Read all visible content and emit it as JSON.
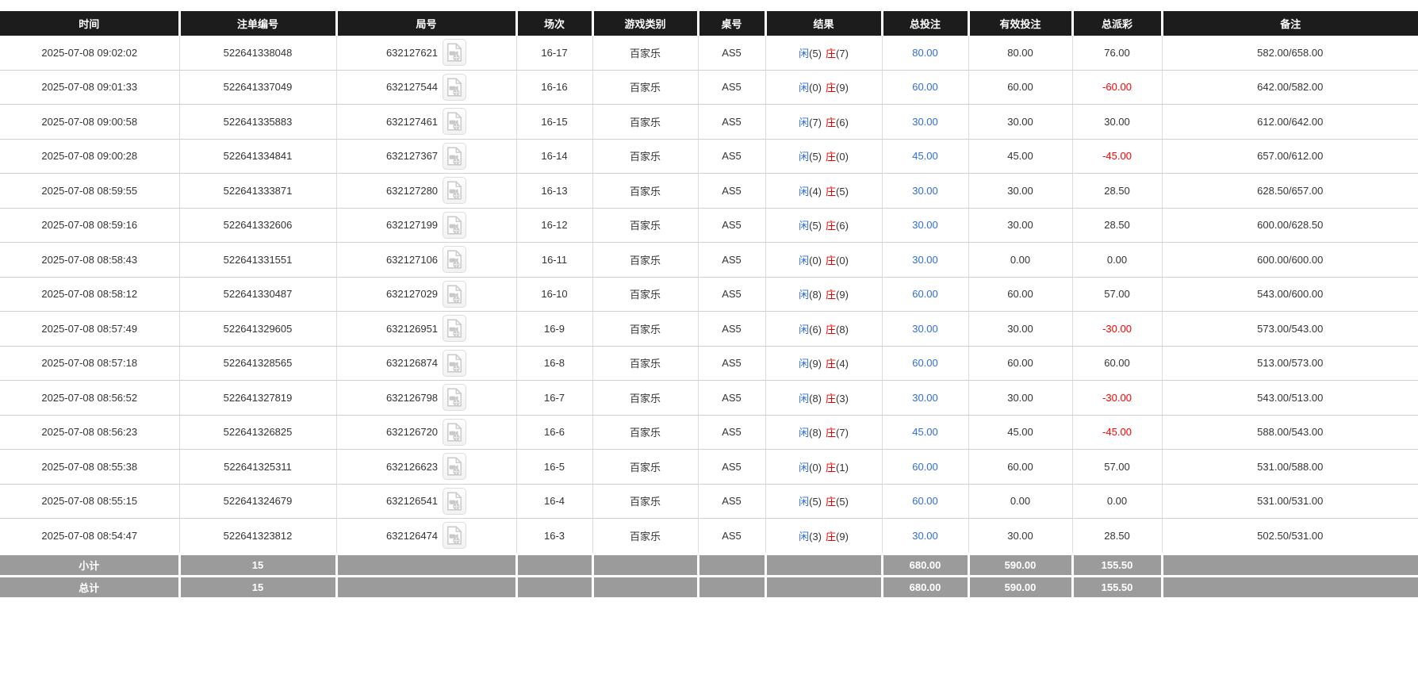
{
  "colors": {
    "header-bg": "#1c1c1c",
    "header-text": "#ffffff",
    "footer-bg": "#9b9b9b",
    "footer-text": "#ffffff",
    "body-text": "#333333",
    "player-blue": "#2f6bd8",
    "banker-red": "#e60000",
    "bet-blue": "#2f6ce0",
    "neg-red": "#ff0000"
  },
  "icons": {
    "video_icon": "video-replay-file"
  },
  "table": {
    "columns": [
      {
        "key": "time",
        "label": "时间"
      },
      {
        "key": "order_no",
        "label": "注单编号"
      },
      {
        "key": "round_no",
        "label": "局号"
      },
      {
        "key": "session",
        "label": "场次"
      },
      {
        "key": "game_type",
        "label": "游戏类别"
      },
      {
        "key": "table_no",
        "label": "桌号"
      },
      {
        "key": "result",
        "label": "结果"
      },
      {
        "key": "total_bet",
        "label": "总投注"
      },
      {
        "key": "valid_bet",
        "label": "有效投注"
      },
      {
        "key": "payout",
        "label": "总派彩"
      },
      {
        "key": "remark",
        "label": "备注"
      }
    ],
    "rows": [
      {
        "time": "2025-07-08 09:02:02",
        "order_no": "522641338048",
        "round_no": "632127621",
        "session": "16-17",
        "game_type": "百家乐",
        "table_no": "AS5",
        "result": {
          "player": "闲",
          "player_score": "(5)",
          "banker": "庄",
          "banker_score": "(7)"
        },
        "total_bet": "80.00",
        "valid_bet": "80.00",
        "payout": "76.00",
        "remark": "582.00/658.00"
      },
      {
        "time": "2025-07-08 09:01:33",
        "order_no": "522641337049",
        "round_no": "632127544",
        "session": "16-16",
        "game_type": "百家乐",
        "table_no": "AS5",
        "result": {
          "player": "闲",
          "player_score": "(0)",
          "banker": "庄",
          "banker_score": "(9)"
        },
        "total_bet": "60.00",
        "valid_bet": "60.00",
        "payout": "-60.00",
        "remark": "642.00/582.00"
      },
      {
        "time": "2025-07-08 09:00:58",
        "order_no": "522641335883",
        "round_no": "632127461",
        "session": "16-15",
        "game_type": "百家乐",
        "table_no": "AS5",
        "result": {
          "player": "闲",
          "player_score": "(7)",
          "banker": "庄",
          "banker_score": "(6)"
        },
        "total_bet": "30.00",
        "valid_bet": "30.00",
        "payout": "30.00",
        "remark": "612.00/642.00"
      },
      {
        "time": "2025-07-08 09:00:28",
        "order_no": "522641334841",
        "round_no": "632127367",
        "session": "16-14",
        "game_type": "百家乐",
        "table_no": "AS5",
        "result": {
          "player": "闲",
          "player_score": "(5)",
          "banker": "庄",
          "banker_score": "(0)"
        },
        "total_bet": "45.00",
        "valid_bet": "45.00",
        "payout": "-45.00",
        "remark": "657.00/612.00"
      },
      {
        "time": "2025-07-08 08:59:55",
        "order_no": "522641333871",
        "round_no": "632127280",
        "session": "16-13",
        "game_type": "百家乐",
        "table_no": "AS5",
        "result": {
          "player": "闲",
          "player_score": "(4)",
          "banker": "庄",
          "banker_score": "(5)"
        },
        "total_bet": "30.00",
        "valid_bet": "30.00",
        "payout": "28.50",
        "remark": "628.50/657.00"
      },
      {
        "time": "2025-07-08 08:59:16",
        "order_no": "522641332606",
        "round_no": "632127199",
        "session": "16-12",
        "game_type": "百家乐",
        "table_no": "AS5",
        "result": {
          "player": "闲",
          "player_score": "(5)",
          "banker": "庄",
          "banker_score": "(6)"
        },
        "total_bet": "30.00",
        "valid_bet": "30.00",
        "payout": "28.50",
        "remark": "600.00/628.50"
      },
      {
        "time": "2025-07-08 08:58:43",
        "order_no": "522641331551",
        "round_no": "632127106",
        "session": "16-11",
        "game_type": "百家乐",
        "table_no": "AS5",
        "result": {
          "player": "闲",
          "player_score": "(0)",
          "banker": "庄",
          "banker_score": "(0)"
        },
        "total_bet": "30.00",
        "valid_bet": "0.00",
        "payout": "0.00",
        "remark": "600.00/600.00"
      },
      {
        "time": "2025-07-08 08:58:12",
        "order_no": "522641330487",
        "round_no": "632127029",
        "session": "16-10",
        "game_type": "百家乐",
        "table_no": "AS5",
        "result": {
          "player": "闲",
          "player_score": "(8)",
          "banker": "庄",
          "banker_score": "(9)"
        },
        "total_bet": "60.00",
        "valid_bet": "60.00",
        "payout": "57.00",
        "remark": "543.00/600.00"
      },
      {
        "time": "2025-07-08 08:57:49",
        "order_no": "522641329605",
        "round_no": "632126951",
        "session": "16-9",
        "game_type": "百家乐",
        "table_no": "AS5",
        "result": {
          "player": "闲",
          "player_score": "(6)",
          "banker": "庄",
          "banker_score": "(8)"
        },
        "total_bet": "30.00",
        "valid_bet": "30.00",
        "payout": "-30.00",
        "remark": "573.00/543.00"
      },
      {
        "time": "2025-07-08 08:57:18",
        "order_no": "522641328565",
        "round_no": "632126874",
        "session": "16-8",
        "game_type": "百家乐",
        "table_no": "AS5",
        "result": {
          "player": "闲",
          "player_score": "(9)",
          "banker": "庄",
          "banker_score": "(4)"
        },
        "total_bet": "60.00",
        "valid_bet": "60.00",
        "payout": "60.00",
        "remark": "513.00/573.00"
      },
      {
        "time": "2025-07-08 08:56:52",
        "order_no": "522641327819",
        "round_no": "632126798",
        "session": "16-7",
        "game_type": "百家乐",
        "table_no": "AS5",
        "result": {
          "player": "闲",
          "player_score": "(8)",
          "banker": "庄",
          "banker_score": "(3)"
        },
        "total_bet": "30.00",
        "valid_bet": "30.00",
        "payout": "-30.00",
        "remark": "543.00/513.00"
      },
      {
        "time": "2025-07-08 08:56:23",
        "order_no": "522641326825",
        "round_no": "632126720",
        "session": "16-6",
        "game_type": "百家乐",
        "table_no": "AS5",
        "result": {
          "player": "闲",
          "player_score": "(8)",
          "banker": "庄",
          "banker_score": "(7)"
        },
        "total_bet": "45.00",
        "valid_bet": "45.00",
        "payout": "-45.00",
        "remark": "588.00/543.00"
      },
      {
        "time": "2025-07-08 08:55:38",
        "order_no": "522641325311",
        "round_no": "632126623",
        "session": "16-5",
        "game_type": "百家乐",
        "table_no": "AS5",
        "result": {
          "player": "闲",
          "player_score": "(0)",
          "banker": "庄",
          "banker_score": "(1)"
        },
        "total_bet": "60.00",
        "valid_bet": "60.00",
        "payout": "57.00",
        "remark": "531.00/588.00"
      },
      {
        "time": "2025-07-08 08:55:15",
        "order_no": "522641324679",
        "round_no": "632126541",
        "session": "16-4",
        "game_type": "百家乐",
        "table_no": "AS5",
        "result": {
          "player": "闲",
          "player_score": "(5)",
          "banker": "庄",
          "banker_score": "(5)"
        },
        "total_bet": "60.00",
        "valid_bet": "0.00",
        "payout": "0.00",
        "remark": "531.00/531.00"
      },
      {
        "time": "2025-07-08 08:54:47",
        "order_no": "522641323812",
        "round_no": "632126474",
        "session": "16-3",
        "game_type": "百家乐",
        "table_no": "AS5",
        "result": {
          "player": "闲",
          "player_score": "(3)",
          "banker": "庄",
          "banker_score": "(9)"
        },
        "total_bet": "30.00",
        "valid_bet": "30.00",
        "payout": "28.50",
        "remark": "502.50/531.00"
      }
    ],
    "footers": [
      {
        "name": "subtotal",
        "label": "小计",
        "count": "15",
        "total_bet": "680.00",
        "valid_bet": "590.00",
        "payout": "155.50"
      },
      {
        "name": "total",
        "label": "总计",
        "count": "15",
        "total_bet": "680.00",
        "valid_bet": "590.00",
        "payout": "155.50"
      }
    ]
  }
}
